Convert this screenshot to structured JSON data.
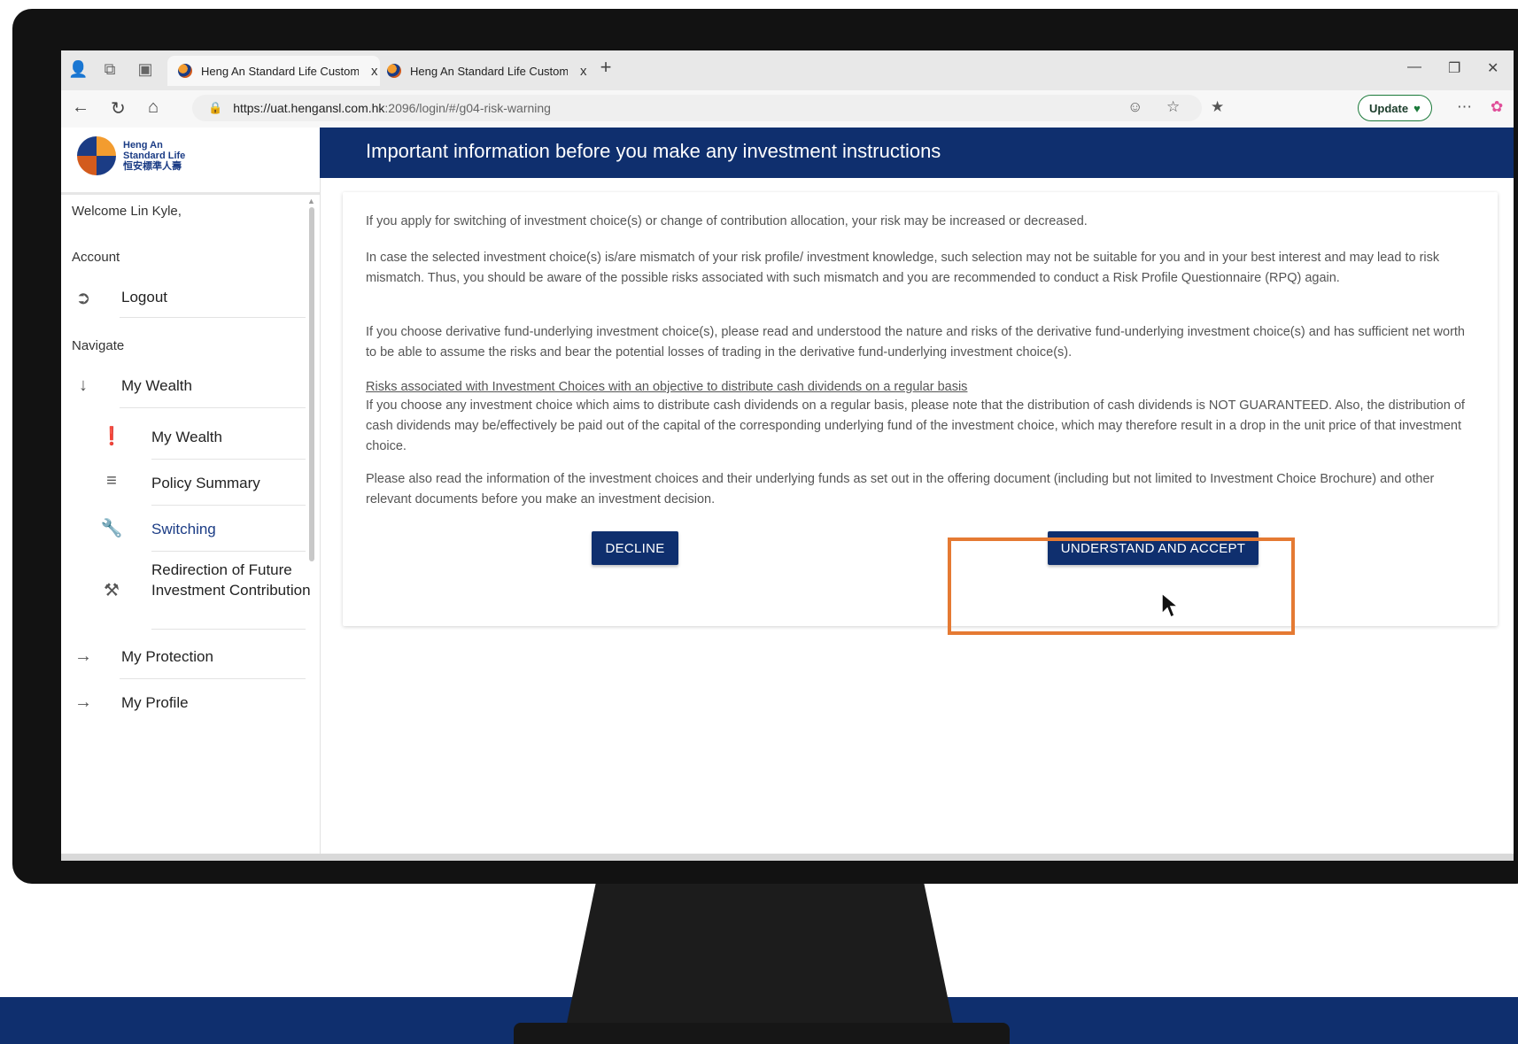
{
  "browser": {
    "tabs": [
      {
        "title": "Heng An Standard Life Customer",
        "close": "x"
      },
      {
        "title": "Heng An Standard Life Customer",
        "close": "x"
      }
    ],
    "new_tab": "+",
    "url_host": "https://uat.hengansl.com.hk",
    "url_path": ":2096/login/#/g04-risk-warning",
    "update_label": "Update"
  },
  "logo": {
    "line1": "Heng An",
    "line2": "Standard Life",
    "line3": "恒安標準人壽"
  },
  "sidebar": {
    "welcome": "Welcome Lin Kyle,",
    "account_heading": "Account",
    "logout": "Logout",
    "navigate_heading": "Navigate",
    "my_wealth_group": "My Wealth",
    "sub_items": [
      {
        "label": "My Wealth",
        "icon": "alert-circle-icon"
      },
      {
        "label": "Policy Summary",
        "icon": "list-icon"
      },
      {
        "label": "Switching",
        "icon": "wrench-icon"
      },
      {
        "label": "Redirection of Future Investment Contribution",
        "icon": "tools-icon"
      }
    ],
    "my_protection": "My Protection",
    "my_profile": "My Profile"
  },
  "main": {
    "title": "Important information before you make any investment instructions",
    "paragraphs": [
      "If you apply for switching of investment choice(s) or change of contribution allocation, your risk may be increased or decreased.",
      "In case the selected investment choice(s) is/are mismatch of your risk profile/ investment knowledge, such selection may not be suitable for you and in your best interest and may lead to risk mismatch. Thus, you should be aware of the possible risks associated with such mismatch and you are recommended to conduct a Risk Profile Questionnaire (RPQ) again.",
      "If you choose derivative fund-underlying investment choice(s), please read and understood the nature and risks of the derivative fund-underlying investment choice(s) and has sufficient net worth to be able to assume the risks and bear the potential losses of trading in the derivative fund-underlying investment choice(s)."
    ],
    "dividend_link": "Risks associated with Investment Choices with an objective to distribute cash dividends on a regular basis",
    "dividend_text": "If you choose any investment choice which aims to distribute cash dividends on a regular basis, please note that the distribution of cash dividends is NOT GUARANTEED. Also, the distribution of cash dividends may be/effectively be paid out of the capital of the corresponding underlying fund of the investment choice, which may therefore result in a drop in the unit price of that investment choice.",
    "closing_text": "Please also read the information of the investment choices and their underlying funds as set out in the offering document (including but not limited to Investment Choice Brochure) and other relevant documents before you make an investment decision.",
    "decline_label": "DECLINE",
    "accept_label": "UNDERSTAND AND ACCEPT"
  },
  "colors": {
    "brand_navy": "#0f2f6e",
    "highlight_orange": "#e57a33"
  }
}
